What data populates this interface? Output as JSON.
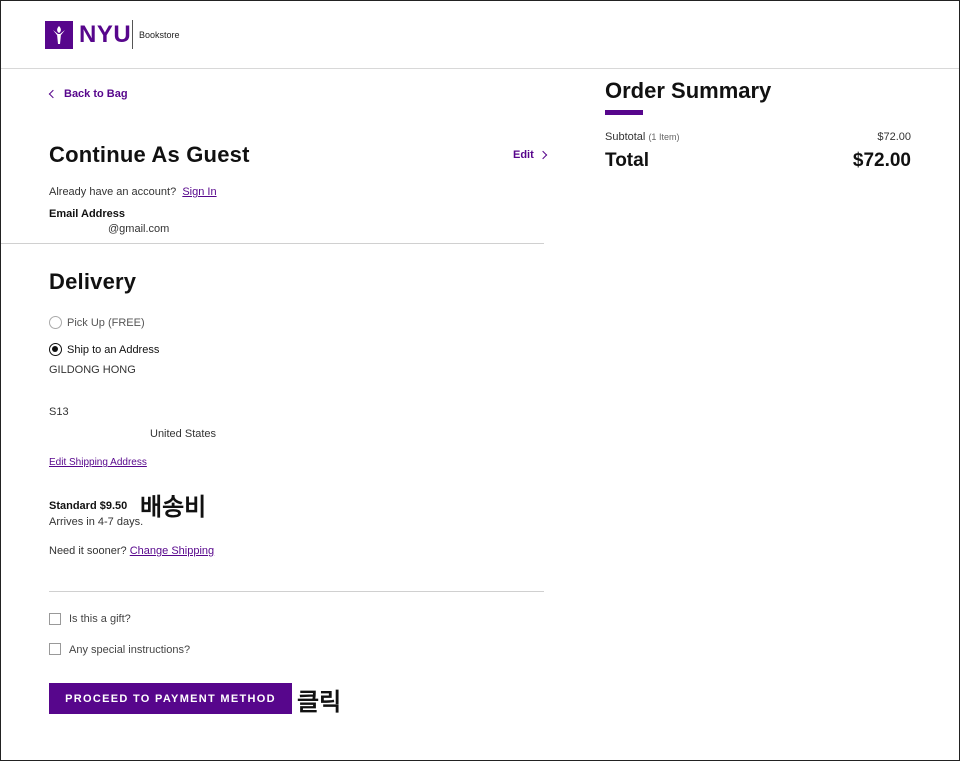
{
  "header": {
    "logo_text": "NYU",
    "logo_sub": "Bookstore"
  },
  "nav": {
    "back_label": "Back to Bag"
  },
  "guest": {
    "title": "Continue As Guest",
    "edit_label": "Edit",
    "account_prompt": "Already have an account?",
    "sign_in_label": "Sign In",
    "email_label": "Email Address",
    "email_value": "@gmail.com"
  },
  "delivery": {
    "title": "Delivery",
    "options": [
      {
        "label": "Pick Up (FREE)",
        "selected": false
      },
      {
        "label": "Ship to an Address",
        "selected": true
      }
    ],
    "address": {
      "name": "GILDONG HONG",
      "line": "S13",
      "country": "United States"
    },
    "edit_address_label": "Edit Shipping Address",
    "shipping_method": "Standard $9.50",
    "arrival": "Arrives in 4-7 days.",
    "sooner_prompt": "Need it sooner?",
    "change_shipping_label": "Change Shipping"
  },
  "extras": {
    "gift_label": "Is this a gift?",
    "instructions_label": "Any special instructions?"
  },
  "actions": {
    "proceed_label": "PROCEED TO PAYMENT METHOD"
  },
  "annotations": {
    "shipping_fee": "배송비",
    "click": "클릭"
  },
  "summary": {
    "title": "Order Summary",
    "subtotal_label": "Subtotal",
    "subtotal_items": "(1 Item)",
    "subtotal_value": "$72.00",
    "total_label": "Total",
    "total_value": "$72.00"
  },
  "colors": {
    "brand": "#57068c"
  }
}
